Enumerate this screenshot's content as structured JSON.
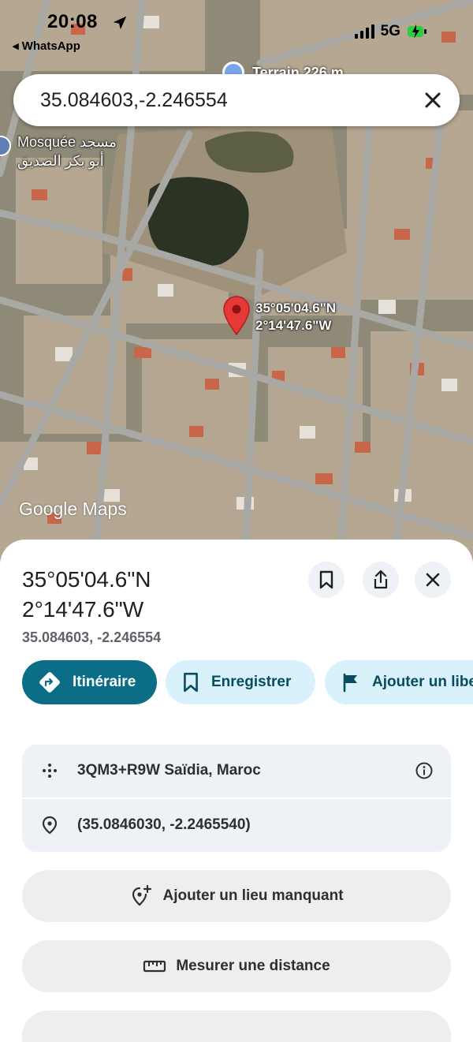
{
  "status_bar": {
    "time": "20:08",
    "back_app": "◂ WhatsApp",
    "network": "5G"
  },
  "map": {
    "poi_top_label": "Terrain 226 m",
    "mosque_label": "Mosquée مسجد أبو بكر الصديق",
    "pin_label": "35°05'04.6\"N\n2°14'47.6\"W",
    "attribution": "Google Maps"
  },
  "search": {
    "query": "35.084603,-2.246554",
    "clear_icon": "close-icon"
  },
  "sheet": {
    "title": "35°05'04.6\"N\n2°14'47.6\"W",
    "subtitle": "35.084603, -2.246554",
    "buttons": {
      "directions": "Itinéraire",
      "save": "Enregistrer",
      "add_label": "Ajouter un libellé"
    },
    "plus_code": "3QM3+R9W Saïdia, Maroc",
    "decimal_coords": "(35.0846030, -2.2465540)",
    "add_missing_place": "Ajouter un lieu manquant",
    "measure_distance": "Mesurer une distance"
  },
  "colors": {
    "primary": "#0b6e86",
    "secondary": "#d8f1fb",
    "pin": "#e53935"
  }
}
